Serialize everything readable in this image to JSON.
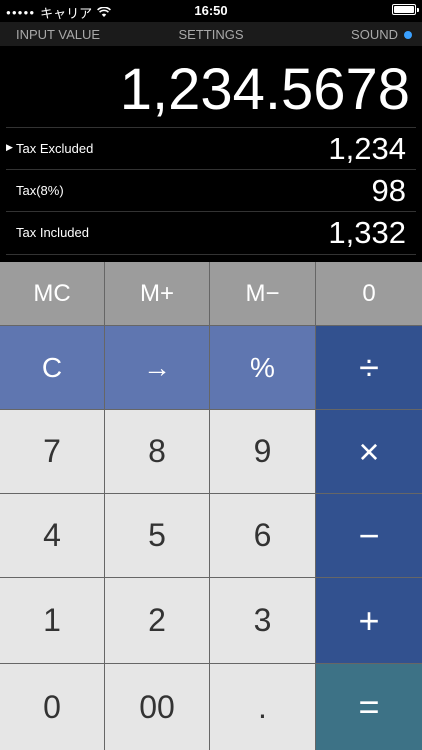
{
  "status": {
    "carrier": "キャリア",
    "time": "16:50",
    "battery_level": 1.0
  },
  "menu": {
    "input_value": "INPUT VALUE",
    "settings": "SETTINGS",
    "sound": "SOUND",
    "sound_indicator_color": "#3aa0ff"
  },
  "display": {
    "main_value": "1,234.5678",
    "rows": [
      {
        "label": "Tax Excluded",
        "value": "1,234",
        "selected": true
      },
      {
        "label": "Tax(8%)",
        "value": "98",
        "selected": false
      },
      {
        "label": "Tax Included",
        "value": "1,332",
        "selected": false
      }
    ],
    "selected_marker": "▶"
  },
  "keys": {
    "mc": "MC",
    "mplus": "M+",
    "mminus": "M−",
    "memory_value": "0",
    "clear": "C",
    "arrow": "→",
    "percent": "%",
    "divide": "÷",
    "seven": "7",
    "eight": "8",
    "nine": "9",
    "multiply": "×",
    "four": "4",
    "five": "5",
    "six": "6",
    "minus": "−",
    "one": "1",
    "two": "2",
    "three": "3",
    "plus": "+",
    "zero": "0",
    "double_zero": "00",
    "dot": ".",
    "equals": "="
  },
  "colors": {
    "memory_keys": "#9c9c9c",
    "function_keys": "#5f76b0",
    "operator_keys": "#32518f",
    "number_keys": "#e6e6e6",
    "equals_key": "#3d7286"
  }
}
